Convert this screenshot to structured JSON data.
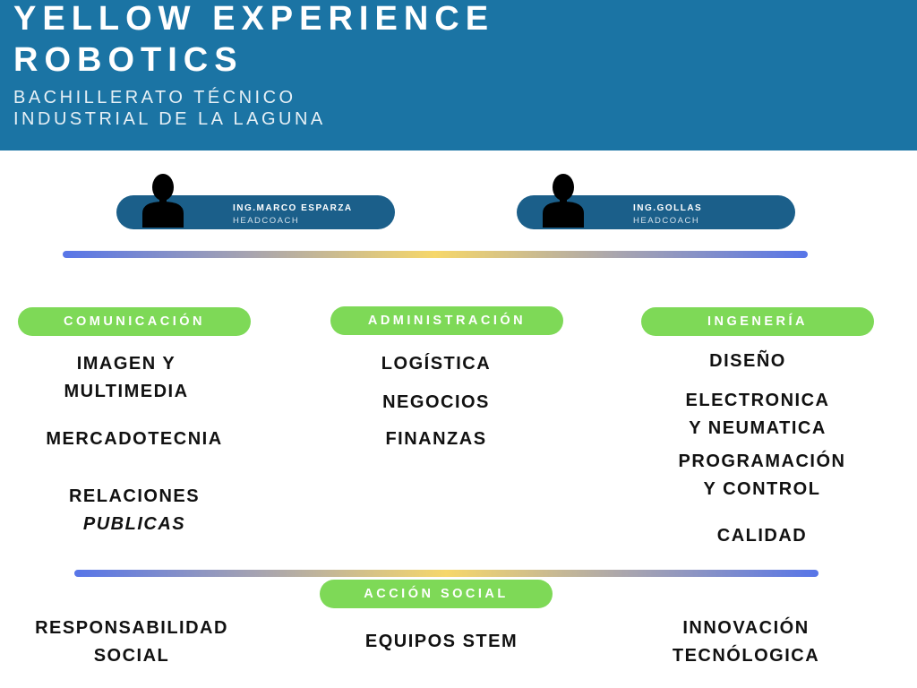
{
  "header": {
    "title_line1": "YELLOW EXPERIENCE",
    "title_line2": "ROBOTICS",
    "subtitle_line1": "BACHILLERATO TÉCNICO",
    "subtitle_line2": "INDUSTRIAL DE LA LAGUNA"
  },
  "coaches": [
    {
      "name": "ING.MARCO ESPARZA",
      "role": "HEADCOACH"
    },
    {
      "name": "ING.GOLLAS",
      "role": "HEADCOACH"
    }
  ],
  "areas": {
    "comunicacion": {
      "label": "COMUNICACIÓN",
      "items": [
        {
          "line1": "IMAGEN Y",
          "line2": "MULTIMEDIA"
        },
        {
          "line1": "MERCADOTECNIA"
        },
        {
          "line1": "RELACIONES",
          "line2": "PUBLICAS"
        }
      ]
    },
    "administracion": {
      "label": "ADMINISTRACIÓN",
      "items": [
        {
          "line1": "LOGÍSTICA"
        },
        {
          "line1": "NEGOCIOS"
        },
        {
          "line1": "FINANZAS"
        }
      ]
    },
    "ingenieria": {
      "label": "INGENERÍA",
      "items": [
        {
          "line1": "DISEÑO"
        },
        {
          "line1": "ELECTRONICA",
          "line2": "Y NEUMATICA"
        },
        {
          "line1": "PROGRAMACIÓN",
          "line2": "Y CONTROL"
        },
        {
          "line1": "CALIDAD"
        }
      ]
    },
    "accion_social": {
      "label": "ACCIÓN SOCIAL",
      "items": [
        {
          "line1": "RESPONSABILIDAD",
          "line2": "SOCIAL"
        },
        {
          "line1": "EQUIPOS STEM"
        },
        {
          "line1": "INNOVACIÓN",
          "line2": "TECNÓLOGICA"
        }
      ]
    }
  },
  "colors": {
    "header_bg": "#1b74a4",
    "coach_pill": "#1b5f8a",
    "category_pill": "#7ed957",
    "divider_start": "#5775e8",
    "divider_mid": "#f6d76a"
  },
  "icons": [
    "person-icon"
  ]
}
